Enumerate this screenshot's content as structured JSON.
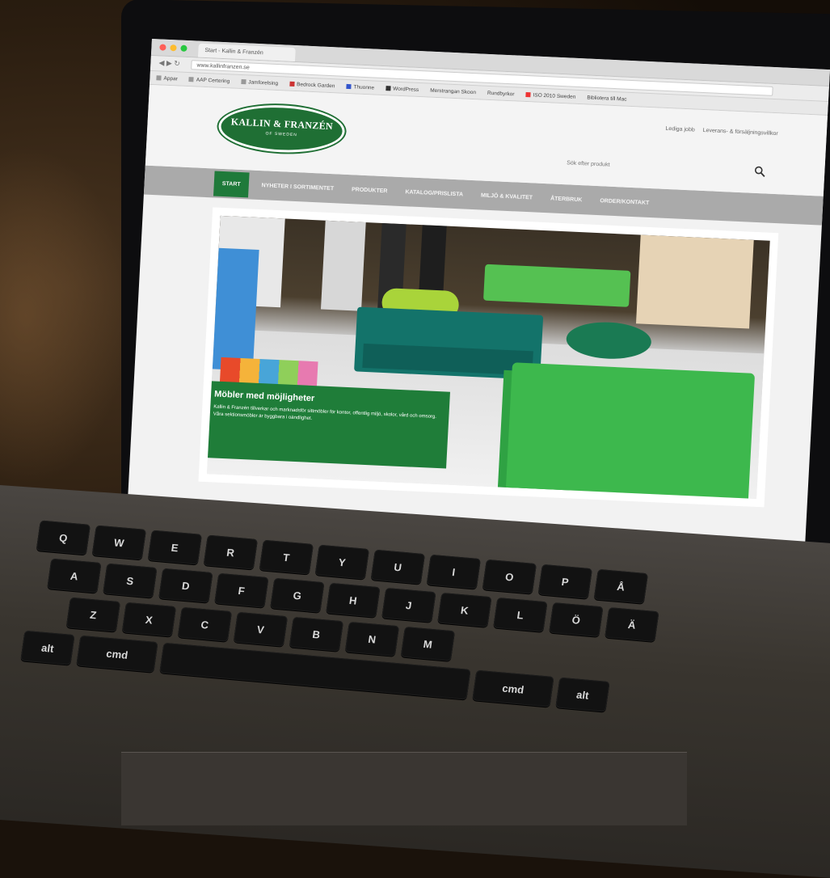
{
  "browser": {
    "tab_title": "Start - Kallin & Franzén",
    "url": "www.kallinfranzen.se",
    "bookmarks": [
      "Appar",
      "AAP Certering",
      "Jamforelsing",
      "Bedrock Garden",
      "Thuonne",
      "WordPress",
      "Merstrangan Skoon",
      "Rundbyrkor",
      "ISO 2010 Sweden",
      "Bibliotera till Mac"
    ]
  },
  "site": {
    "logo_text": "KALLIN & FRANZÉN",
    "logo_sub": "OF SWEDEN",
    "top_links": [
      "Lediga jobb",
      "Leverans- & försäljningsvillkor"
    ],
    "search_placeholder": "Sök efter produkt",
    "nav": [
      "START",
      "NYHETER I SORTIMENTET",
      "PRODUKTER",
      "KATALOG/PRISLISTA",
      "MILJÖ & KVALITET",
      "ÅTERBRUK",
      "ORDER/KONTAKT"
    ],
    "hero": {
      "heading": "Möbler med möjligheter",
      "text": "Kallin & Franzén tillverkar och marknadsför sittmöbler för kontor, offentlig miljö, skolor, vård och omsorg. Våra sektionsmöbler är byggbara i oändlighet."
    }
  },
  "keyboard": {
    "rows": [
      [
        "Q",
        "W",
        "E",
        "R",
        "T",
        "Y",
        "U",
        "I",
        "O",
        "P",
        "Å"
      ],
      [
        "A",
        "S",
        "D",
        "F",
        "G",
        "H",
        "J",
        "K",
        "L",
        "Ö",
        "Ä"
      ],
      [
        "Z",
        "X",
        "C",
        "V",
        "B",
        "N",
        "M"
      ]
    ],
    "keys_left": [
      "alt",
      "cmd"
    ],
    "keys_right": [
      "cmd",
      "alt"
    ]
  },
  "colors": {
    "brand_green": "#1f7a3a",
    "nav_gray": "#aaaaaa"
  }
}
